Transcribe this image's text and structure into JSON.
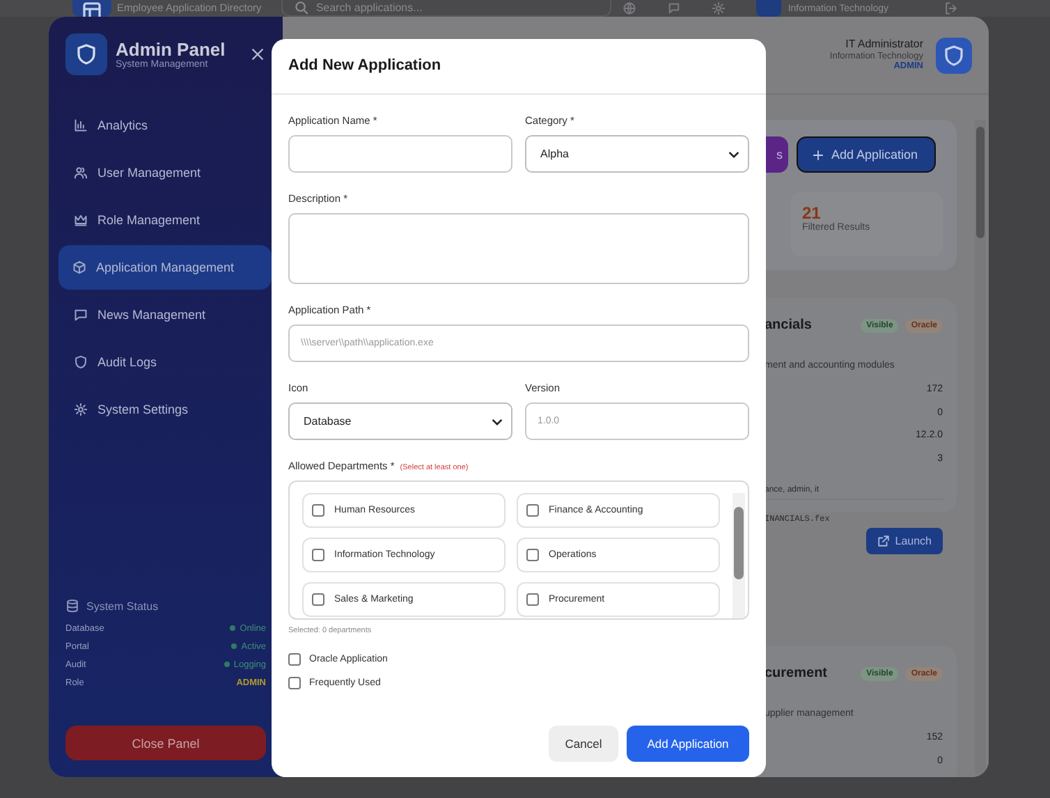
{
  "portal_header": {
    "subtitle": "Employee Application Directory",
    "search": {
      "placeholder": "Search applications..."
    },
    "user_department": "Information Technology"
  },
  "admin_panel": {
    "title": "Admin Panel",
    "subtitle": "System Management",
    "nav": [
      {
        "label": "Analytics",
        "selected": false
      },
      {
        "label": "User Management",
        "selected": false
      },
      {
        "label": "Role Management",
        "selected": false
      },
      {
        "label": "Application Management",
        "selected": true
      },
      {
        "label": "News Management",
        "selected": false
      },
      {
        "label": "Audit Logs",
        "selected": false
      },
      {
        "label": "System Settings",
        "selected": false
      }
    ],
    "system_status": {
      "title": "System Status",
      "rows": [
        {
          "label": "Database",
          "value": "Online",
          "kind": "dot"
        },
        {
          "label": "Portal",
          "value": "Active",
          "kind": "dot"
        },
        {
          "label": "Audit",
          "value": "Logging",
          "kind": "dot"
        },
        {
          "label": "Role",
          "value": "ADMIN",
          "kind": "role"
        }
      ]
    },
    "close_button": "Close Panel"
  },
  "admin_header": {
    "user_name": "IT Administrator",
    "department": "Information Technology",
    "role": "ADMIN"
  },
  "toolbar": [
    {
      "label": "s",
      "kind": "secondary"
    },
    {
      "label": "Add Application",
      "kind": "primary"
    }
  ],
  "stats": [
    {
      "value": "21",
      "label": "Filtered Results"
    }
  ],
  "app_cards": [
    {
      "title": "ancials",
      "badges": [
        {
          "label": "Visible",
          "kind": "visible"
        },
        {
          "label": "Oracle",
          "kind": "oracle"
        }
      ],
      "description": "ment and accounting modules",
      "values": [
        "172",
        "0",
        "12.2.0",
        "3"
      ],
      "departments": "ance, admin, it",
      "path": "INANCIALS.fex",
      "launch": "Launch"
    },
    {
      "title": "curement",
      "badges": [
        {
          "label": "Visible",
          "kind": "visible"
        },
        {
          "label": "Oracle",
          "kind": "oracle"
        }
      ],
      "description": "upplier management",
      "values": [
        "152",
        "0"
      ]
    }
  ],
  "modal": {
    "title": "Add New Application",
    "name": {
      "label": "Application Name *"
    },
    "category": {
      "label": "Category *",
      "value": "Alpha"
    },
    "description": {
      "label": "Description *"
    },
    "path": {
      "label": "Application Path *",
      "placeholder": "\\\\\\\\server\\\\path\\\\application.exe"
    },
    "icon": {
      "label": "Icon",
      "value": "Database"
    },
    "version": {
      "label": "Version",
      "placeholder": "1.0.0"
    },
    "departments": {
      "label": "Allowed Departments *",
      "hint": "(Select at least one)",
      "items": [
        {
          "label": "Human Resources",
          "checked": false
        },
        {
          "label": "Finance & Accounting",
          "checked": false
        },
        {
          "label": "Information Technology",
          "checked": false
        },
        {
          "label": "Operations",
          "checked": false
        },
        {
          "label": "Sales & Marketing",
          "checked": false
        },
        {
          "label": "Procurement",
          "checked": false
        }
      ],
      "summary": "Selected: 0 departments"
    },
    "options": [
      {
        "label": "Oracle Application",
        "checked": false
      },
      {
        "label": "Frequently Used",
        "checked": false
      }
    ],
    "cancel": "Cancel",
    "submit": "Add Application"
  }
}
